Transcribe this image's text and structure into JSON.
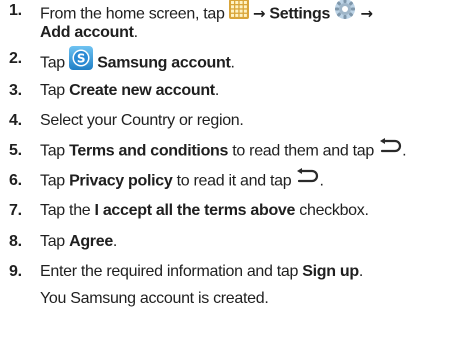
{
  "steps": [
    {
      "number": "1.",
      "parts": [
        "From the home screen, tap",
        "→",
        "Settings",
        "→"
      ],
      "cont": "Add account",
      "cont_end": ".",
      "icons": [
        "apps-grid-icon",
        "settings-gear-icon"
      ]
    },
    {
      "number": "2.",
      "parts": [
        "Tap",
        "Samsung account",
        "."
      ],
      "icons": [
        "samsung-account-icon"
      ]
    },
    {
      "number": "3.",
      "parts": [
        "Tap",
        "Create new account",
        "."
      ]
    },
    {
      "number": "4.",
      "parts": [
        "Select your Country or region."
      ]
    },
    {
      "number": "5.",
      "parts": [
        "Tap",
        "Terms and conditions",
        "to read them and tap",
        "."
      ],
      "icons": [
        "back-arrow-icon"
      ]
    },
    {
      "number": "6.",
      "parts": [
        "Tap",
        "Privacy policy",
        "to read it and tap",
        "."
      ],
      "icons": [
        "back-arrow-icon"
      ]
    },
    {
      "number": "7.",
      "parts": [
        "Tap the",
        "I accept all the terms above",
        "checkbox."
      ]
    },
    {
      "number": "8.",
      "parts": [
        "Tap",
        "Agree",
        "."
      ]
    },
    {
      "number": "9.",
      "parts": [
        "Enter the required information and tap",
        "Sign up",
        "."
      ],
      "cont": "You Samsung account is created."
    }
  ]
}
